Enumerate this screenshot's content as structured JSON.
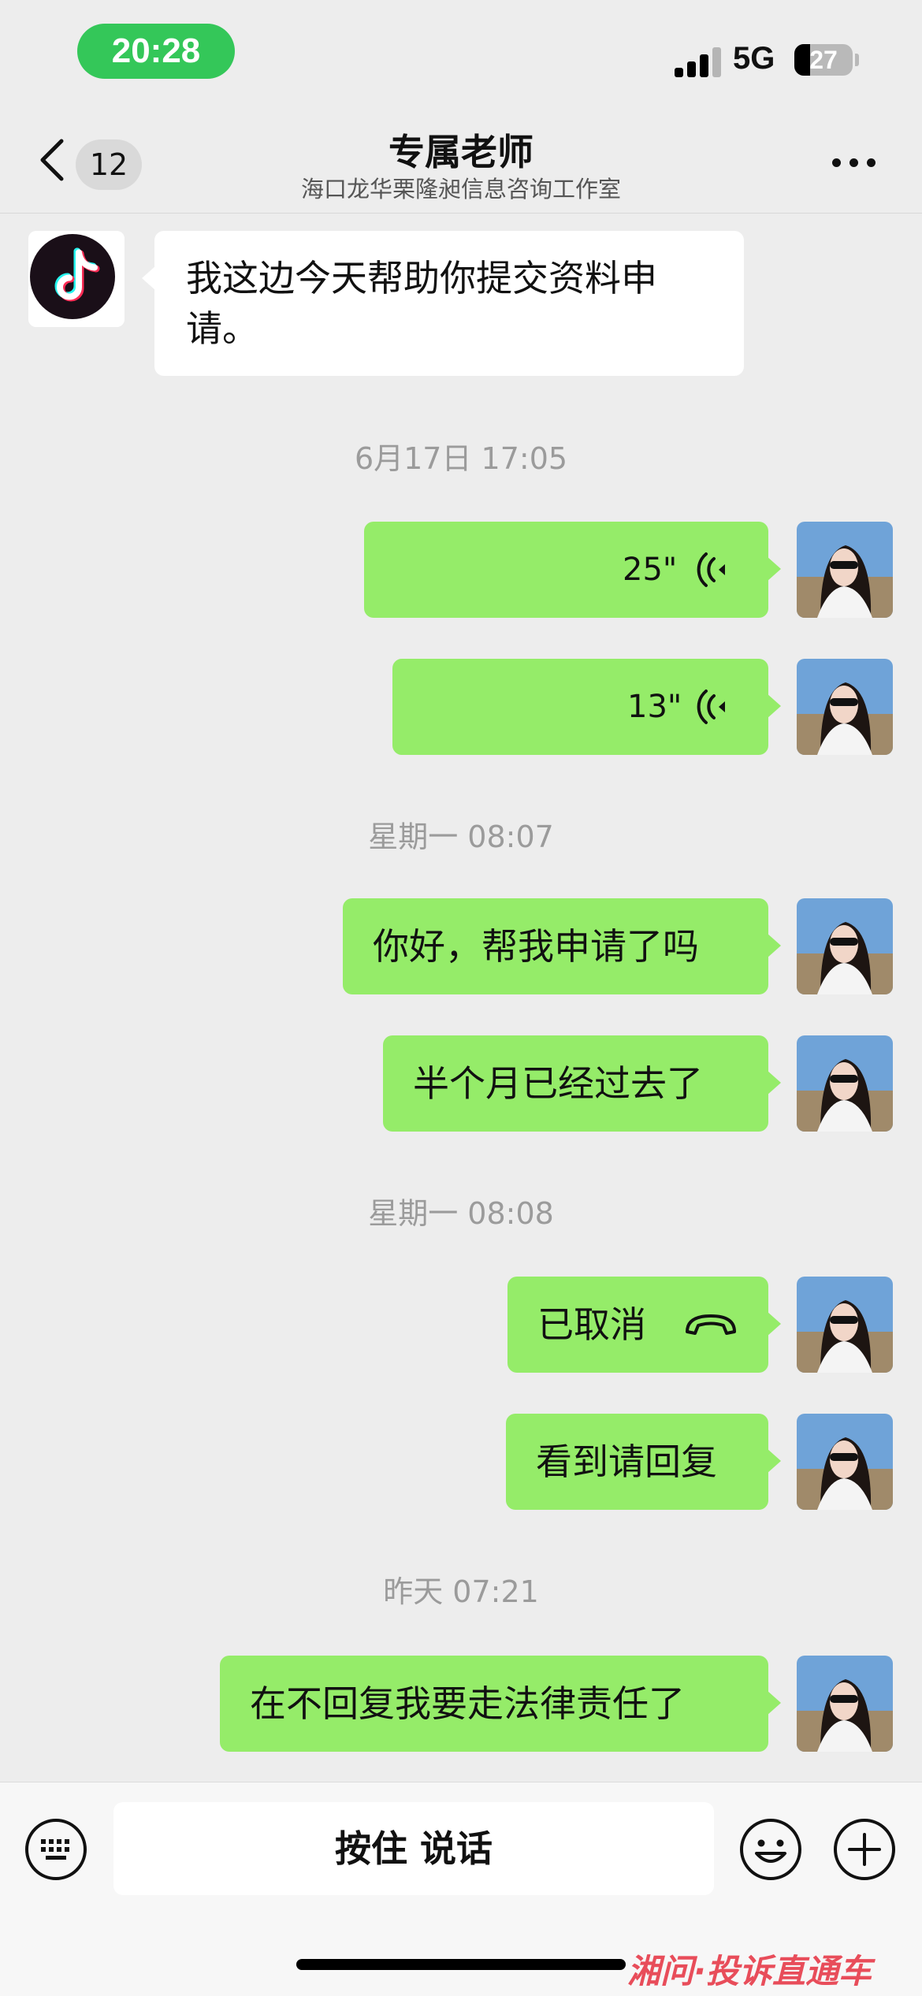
{
  "status_bar": {
    "time": "20:28",
    "network": "5G",
    "battery": "27"
  },
  "nav": {
    "back_count": "12",
    "title": "专属老师",
    "subtitle": "海口龙华栗隆昶信息咨询工作室"
  },
  "messages": {
    "m1": {
      "text": "我这边今天帮助你提交资料申请。"
    },
    "t1": "6月17日 17:05",
    "v1": "25\"",
    "v2": "13\"",
    "t2": "星期一 08:07",
    "m2": "你好，帮我申请了吗",
    "m3": "半个月已经过去了",
    "t3": "星期一 08:08",
    "m4": "已取消",
    "m5": "看到请回复",
    "t4": "昨天 07:21",
    "m6": "在不回复我要走法律责任了"
  },
  "input": {
    "hold_label": "按住 说话"
  },
  "watermark": "湘问·投诉直通车",
  "colors": {
    "outgoing_bubble": "#95ec69",
    "incoming_bubble": "#ffffff",
    "background": "#ededed",
    "time_pill": "#34c759"
  }
}
